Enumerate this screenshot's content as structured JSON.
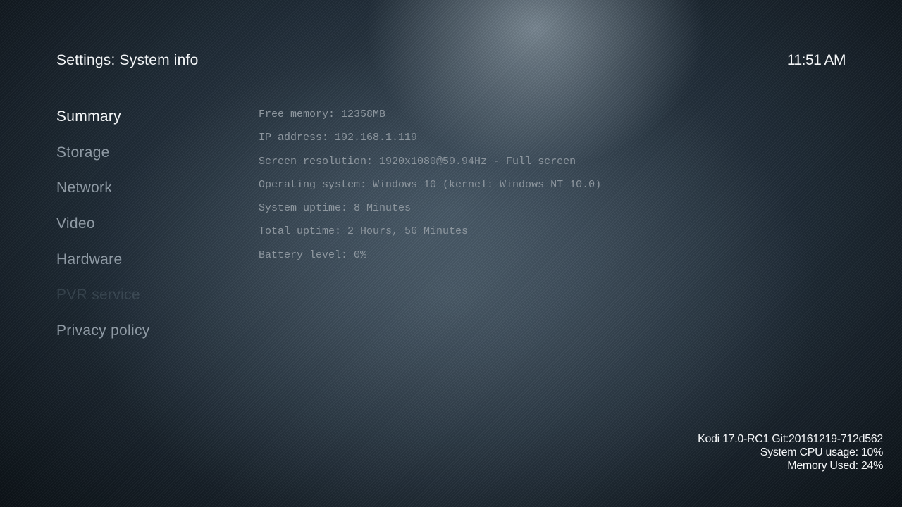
{
  "header": {
    "title": "Settings: System info",
    "clock": "11:51 AM"
  },
  "menu": {
    "items": [
      {
        "label": "Summary"
      },
      {
        "label": "Storage"
      },
      {
        "label": "Network"
      },
      {
        "label": "Video"
      },
      {
        "label": "Hardware"
      },
      {
        "label": "PVR service"
      },
      {
        "label": "Privacy policy"
      }
    ]
  },
  "info": {
    "lines": [
      "Free memory: 12358MB",
      "IP address: 192.168.1.119",
      "Screen resolution: 1920x1080@59.94Hz - Full screen",
      "Operating system: Windows 10 (kernel: Windows NT 10.0)",
      "System uptime: 8 Minutes",
      "Total uptime: 2 Hours, 56 Minutes",
      "Battery level: 0%"
    ]
  },
  "footer": {
    "version": "Kodi 17.0-RC1 Git:20161219-712d562",
    "cpu_usage": "System CPU usage: 10%",
    "memory_used": "Memory Used: 24%"
  }
}
